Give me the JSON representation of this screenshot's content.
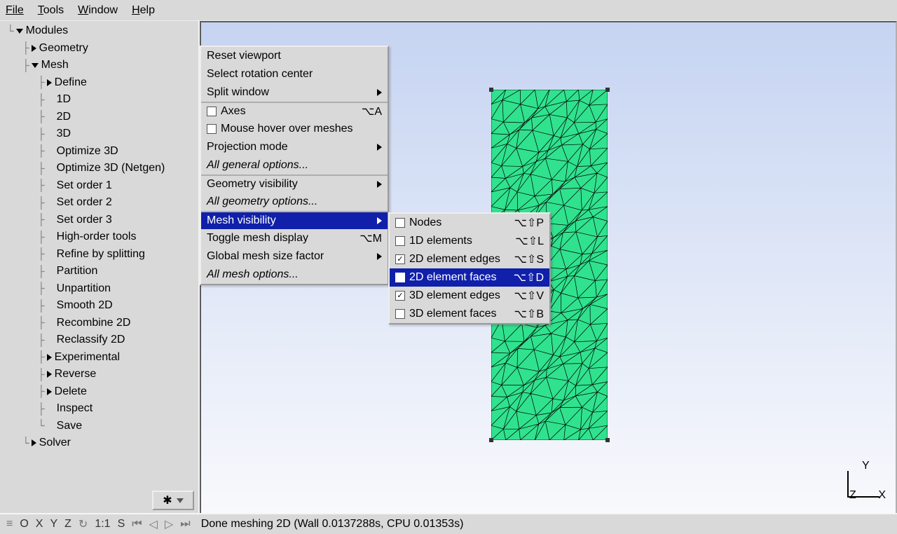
{
  "menubar": {
    "file": "File",
    "tools": "Tools",
    "window": "Window",
    "help": "Help"
  },
  "tree": {
    "root": "Modules",
    "geometry": "Geometry",
    "mesh": "Mesh",
    "mesh_items": [
      "Define",
      "1D",
      "2D",
      "3D",
      "Optimize 3D",
      "Optimize 3D (Netgen)",
      "Set order 1",
      "Set order 2",
      "Set order 3",
      "High-order tools",
      "Refine by splitting",
      "Partition",
      "Unpartition",
      "Smooth 2D",
      "Recombine 2D",
      "Reclassify 2D",
      "Experimental",
      "Reverse",
      "Delete",
      "Inspect",
      "Save"
    ],
    "solver": "Solver"
  },
  "context1": {
    "reset": "Reset viewport",
    "rotcenter": "Select rotation center",
    "split": "Split window",
    "axes": "Axes",
    "axes_sc": "⌥A",
    "mousehover": "Mouse hover over meshes",
    "projection": "Projection mode",
    "allgen": "All general options...",
    "geomvis": "Geometry visibility",
    "allgeom": "All geometry options...",
    "meshvis": "Mesh visibility",
    "togglemesh": "Toggle mesh display",
    "togglemesh_sc": "⌥M",
    "globalmesh": "Global mesh size factor",
    "allmesh": "All mesh options..."
  },
  "submenu": {
    "items": [
      {
        "label": "Nodes",
        "sc": "⌥⇧P",
        "checked": false
      },
      {
        "label": "1D elements",
        "sc": "⌥⇧L",
        "checked": false
      },
      {
        "label": "2D element edges",
        "sc": "⌥⇧S",
        "checked": true
      },
      {
        "label": "2D element faces",
        "sc": "⌥⇧D",
        "checked": true,
        "highlight": true
      },
      {
        "label": "3D element edges",
        "sc": "⌥⇧V",
        "checked": true
      },
      {
        "label": "3D element faces",
        "sc": "⌥⇧B",
        "checked": false
      }
    ]
  },
  "axes": {
    "x": "X",
    "y": "Y",
    "z": "Z"
  },
  "statusbar": {
    "btns": [
      "O",
      "X",
      "Y",
      "Z"
    ],
    "scale": "1:1",
    "s": "S",
    "msg": "Done meshing 2D (Wall 0.0137288s, CPU 0.01353s)"
  }
}
